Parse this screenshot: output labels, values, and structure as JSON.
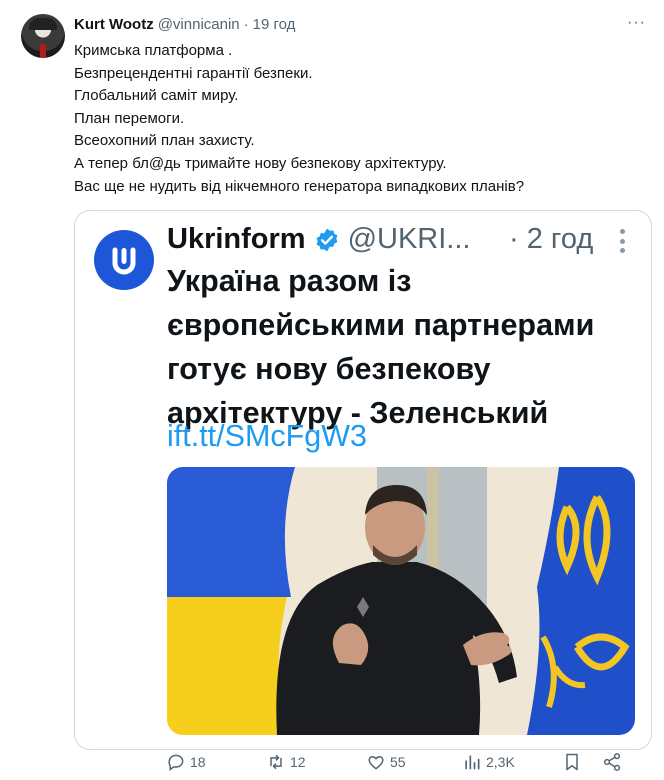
{
  "tweet": {
    "author_name": "Kurt Wootz",
    "author_handle": "@vinnicanin",
    "separator": "·",
    "time": "19 год",
    "more_label": "···",
    "lines": [
      "Кримська платформа .",
      "Безпрецендентні гарантії безпеки.",
      "Глобальний саміт миру.",
      "План перемоги.",
      "Всеохопний план захисту.",
      "А тепер бл@дь тримайте нову безпекову архітектуру.",
      "Вас ще не нудить від нікчемного генератора випадкових планів?"
    ]
  },
  "quoted": {
    "author_name": "Ukrinform",
    "author_handle": "@UKRI...",
    "time": "· 2 год",
    "lines": [
      "Україна разом із",
      "європейськими партнерами",
      "готує нову безпекову",
      "архітектуру - Зеленський"
    ],
    "link": "ift.tt/SMcFgW3",
    "colors": {
      "flag_blue": "#2a5bd7",
      "flag_yellow": "#f6cf1d",
      "brand_blue": "#1d56d8"
    }
  },
  "actions": {
    "replies": "18",
    "reposts": "12",
    "likes": "55",
    "views": "2,3K"
  },
  "icons": [
    "reply-icon",
    "repost-icon",
    "like-icon",
    "views-icon",
    "bookmark-icon",
    "share-icon",
    "verified-icon"
  ]
}
